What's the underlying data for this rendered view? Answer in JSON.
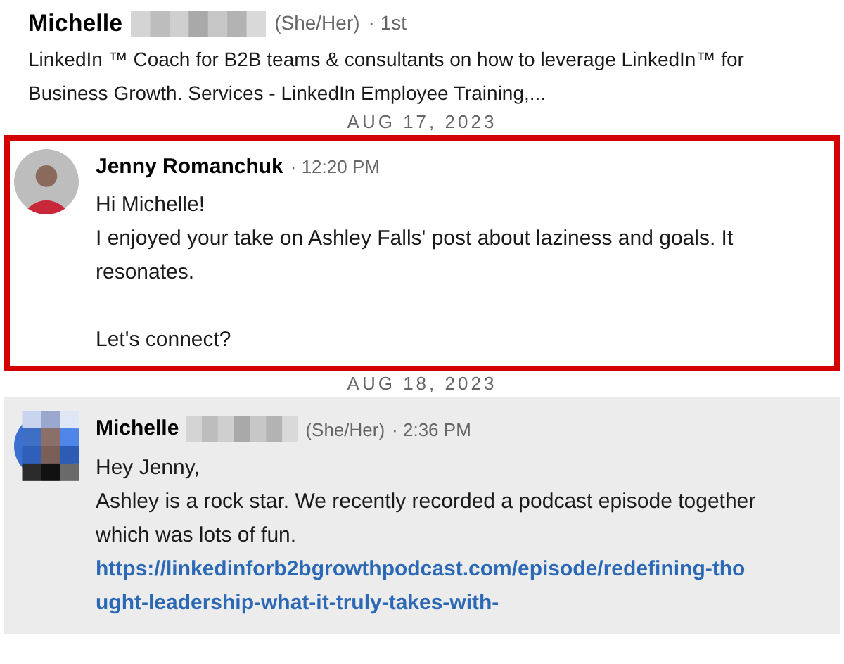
{
  "profile": {
    "first_name": "Michelle",
    "pronouns": "(She/Her)",
    "degree": "· 1st",
    "headline": "LinkedIn ™ Coach for B2B teams & consultants on how to leverage LinkedIn™ for Business Growth. Services - LinkedIn Employee Training,..."
  },
  "messages": [
    {
      "date": "AUG 17, 2023",
      "sender": "Jenny Romanchuk",
      "surname_redacted": false,
      "time": "· 12:20 PM",
      "outlined": true,
      "shaded": false,
      "kind": "photo",
      "paragraphs": [
        [
          "Hi Michelle!",
          "I enjoyed your take on Ashley Falls' post about laziness and goals. It resonates."
        ],
        [
          "Let's connect?"
        ]
      ]
    },
    {
      "date": "AUG 18, 2023",
      "sender": "Michelle",
      "surname_redacted": true,
      "pronouns": "(She/Her)",
      "time": "· 2:36 PM",
      "outlined": false,
      "shaded": true,
      "kind": "pixelated",
      "paragraphs": [
        [
          "Hey Jenny,",
          "Ashley is a rock star. We recently recorded a podcast episode together which was lots of fun."
        ]
      ],
      "link": "https://linkedinforb2bgrowthpodcast.com/episode/redefining-thought-leadership-what-it-truly-takes-with-"
    }
  ]
}
